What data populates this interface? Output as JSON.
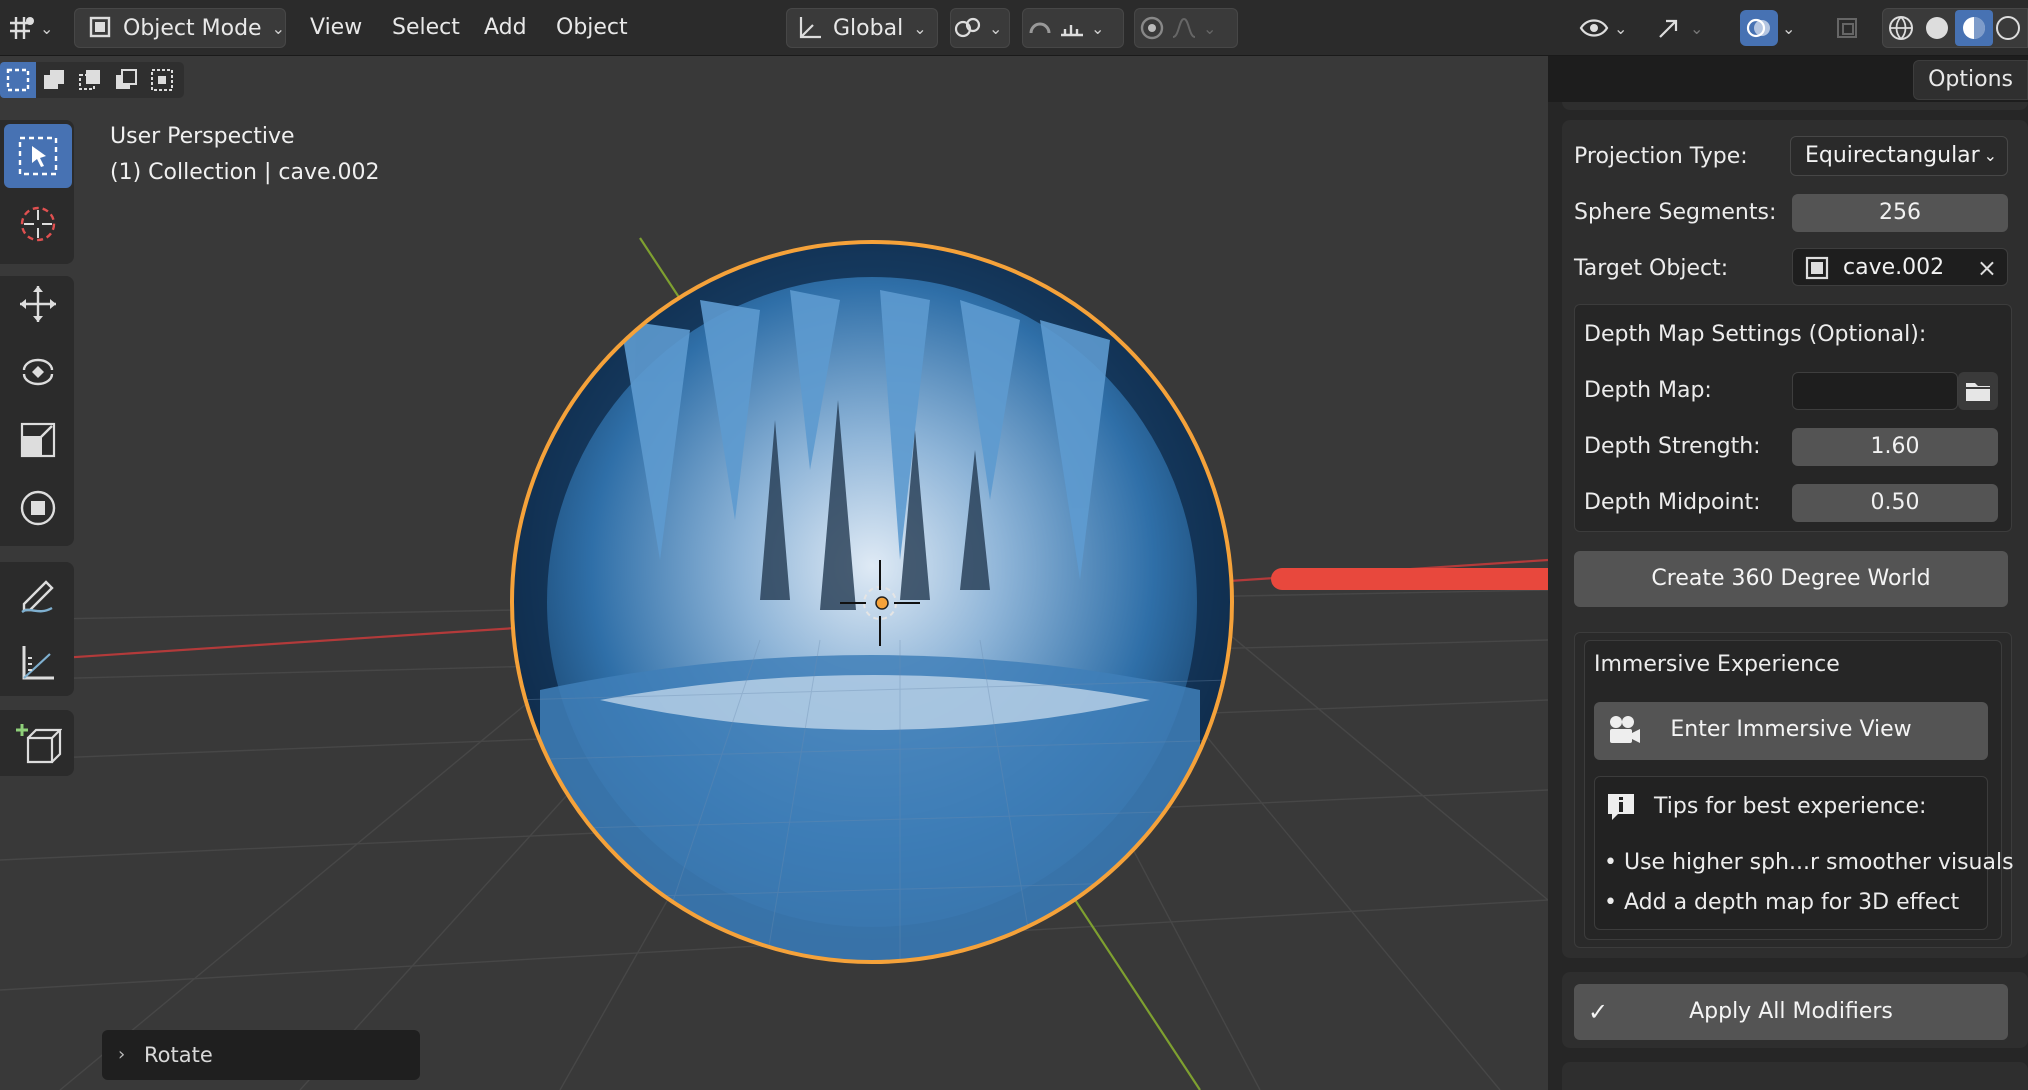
{
  "header": {
    "mode_label": "Object Mode",
    "menus": [
      "View",
      "Select",
      "Add",
      "Object"
    ],
    "transform_orientation": "Global"
  },
  "options_label": "Options",
  "viewport": {
    "view_name": "User Perspective",
    "collection_info": "(1) Collection | cave.002",
    "last_operator": "Rotate"
  },
  "sidebar": {
    "projection_type_label": "Projection Type:",
    "projection_type_value": "Equirectangular",
    "sphere_segments_label": "Sphere Segments:",
    "sphere_segments_value": "256",
    "target_object_label": "Target Object:",
    "target_object_value": "cave.002",
    "depth_section_title": "Depth Map Settings (Optional):",
    "depth_map_label": "Depth Map:",
    "depth_map_value": "",
    "depth_strength_label": "Depth Strength:",
    "depth_strength_value": "1.60",
    "depth_midpoint_label": "Depth Midpoint:",
    "depth_midpoint_value": "0.50",
    "create_button": "Create 360 Degree World",
    "immersive_title": "Immersive Experience",
    "enter_immersive_button": "Enter Immersive View",
    "tips_title": "Tips for best experience:",
    "tips": [
      "Use higher sph...r smoother visuals",
      "Add a depth map for 3D effect"
    ],
    "apply_button": "Apply All Modifiers"
  },
  "colors": {
    "accent_blue": "#4772b3",
    "selection_orange": "#f5a23a",
    "annotation_arrow": "#e8483d",
    "x_axis": "#b33a3a",
    "y_axis": "#7ea030"
  }
}
